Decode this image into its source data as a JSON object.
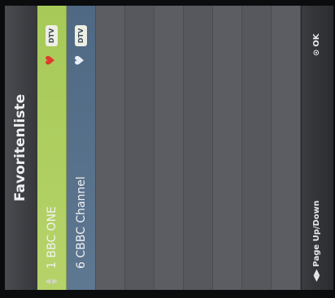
{
  "title": "Favoritenliste",
  "colors": {
    "selected_row": "#a6c957",
    "normal_row": "#5e7892",
    "heart_active": "#e03a2c",
    "heart_inactive": "#e8eef5"
  },
  "channels": [
    {
      "label": "1 BBC ONE",
      "badge": "DTV",
      "arrows_icon": "up-down-arrows-icon",
      "heart_icon": "heart-icon",
      "selected": true
    },
    {
      "label": "6 CBBC Channel",
      "badge": "DTV",
      "heart_icon": "heart-icon",
      "selected": false
    }
  ],
  "footer": {
    "page_label": "Page Up/Down",
    "page_icon": "left-right-arrows-icon",
    "page_glyph": "◀▶",
    "ok_label": "OK",
    "ok_icon": "ok-button-icon",
    "ok_glyph": "⊙"
  },
  "glyphs": {
    "arrows": "▲\n▼",
    "heart": "♥"
  }
}
